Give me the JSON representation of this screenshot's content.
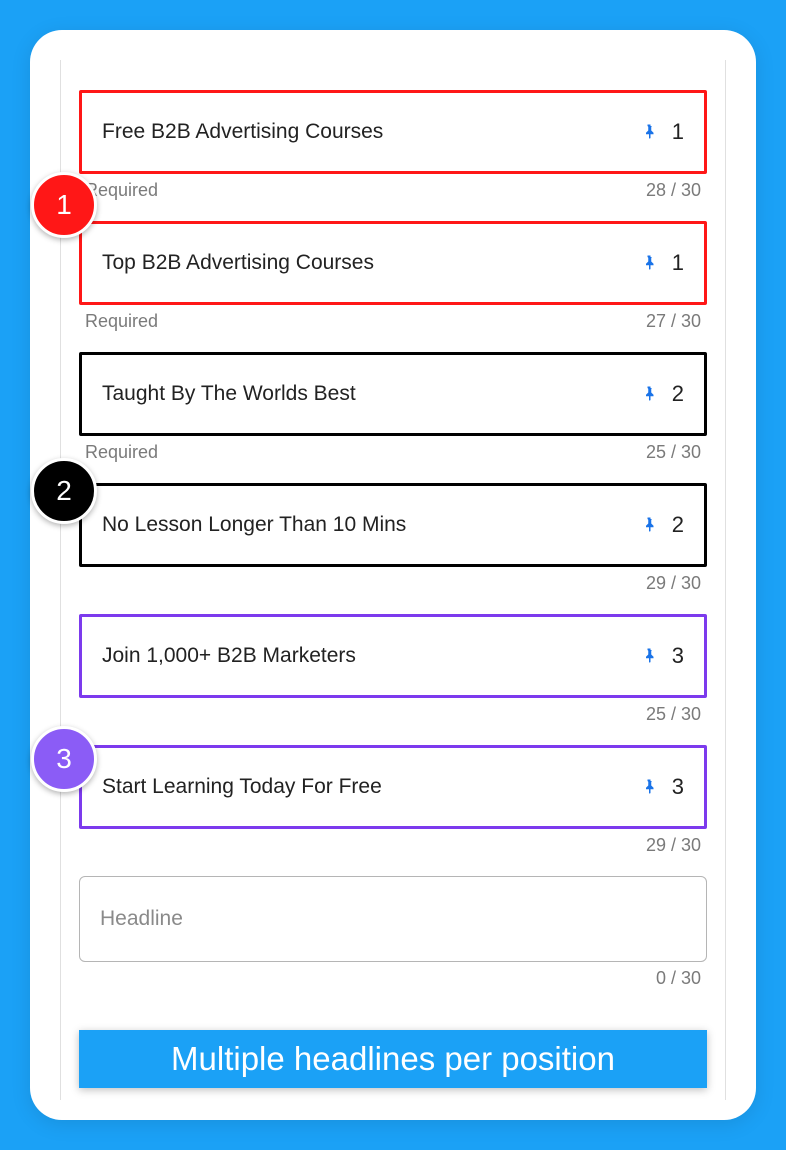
{
  "badges": [
    "1",
    "2",
    "3"
  ],
  "rows": [
    {
      "text": "Free B2B Advertising Courses",
      "pin": "1",
      "required": "Required",
      "count": "28 / 30",
      "color": "red"
    },
    {
      "text": "Top B2B Advertising Courses",
      "pin": "1",
      "required": "Required",
      "count": "27 / 30",
      "color": "red"
    },
    {
      "text": "Taught By The Worlds Best",
      "pin": "2",
      "required": "Required",
      "count": "25 / 30",
      "color": "black"
    },
    {
      "text": "No Lesson Longer Than 10 Mins",
      "pin": "2",
      "required": "",
      "count": "29 / 30",
      "color": "black"
    },
    {
      "text": "Join 1,000+ B2B Marketers",
      "pin": "3",
      "required": "",
      "count": "25 / 30",
      "color": "purple"
    },
    {
      "text": "Start Learning Today For Free",
      "pin": "3",
      "required": "",
      "count": "29 / 30",
      "color": "purple"
    }
  ],
  "empty": {
    "placeholder": "Headline",
    "count": "0 / 30"
  },
  "caption": "Multiple headlines per position"
}
